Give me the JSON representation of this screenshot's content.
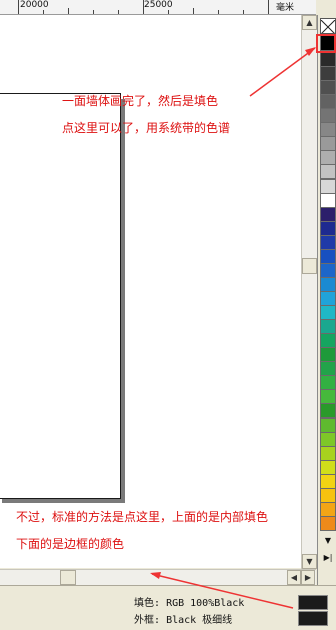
{
  "ruler": {
    "label_left": "20000",
    "label_right": "25000",
    "unit": "毫米"
  },
  "annotations": {
    "top_line1": "一面墙体画完了，然后是填色",
    "top_line2": "点这里可以了，用系统带的色谱",
    "bottom_line1": "不过，标准的方法是点这里，上面的是内部填色",
    "bottom_line2": "下面的是边框的颜色"
  },
  "palette": {
    "no_color_label": "no-fill",
    "selected": "#000000",
    "swatches": [
      "#2a2a2a",
      "#3d3d3d",
      "#505050",
      "#626262",
      "#747474",
      "#878787",
      "#9a9a9a",
      "#aeaeae",
      "#c2c2c2",
      "#d7d7d7",
      "#ffffff",
      "#2c1f6b",
      "#1e2a90",
      "#1f3aa8",
      "#1850c0",
      "#1d66c9",
      "#1a8ad2",
      "#20a3d9",
      "#1fb7c6",
      "#1aa88f",
      "#16a560",
      "#1e9a3a",
      "#22a34a",
      "#32b042",
      "#46b93c",
      "#2a9a2a",
      "#5fba2f",
      "#7ec728",
      "#a8d21e",
      "#d0de1a",
      "#f1d314",
      "#f6c20f",
      "#f2a516",
      "#ee8a1a"
    ]
  },
  "status": {
    "fill_label": "填色:",
    "fill_value": "RGB 100%Black",
    "outline_label": "外框:",
    "outline_value": "Black  极细线"
  },
  "icons": {
    "no_color": "no-fill-icon",
    "scroll_up": "scroll-up-icon",
    "scroll_down": "scroll-down-icon",
    "scroll_left": "scroll-left-icon",
    "scroll_right": "scroll-right-icon",
    "palette_down": "palette-down-icon",
    "palette_expand": "palette-expand-icon"
  },
  "colors": {
    "annotation": "#dd1111",
    "highlight": "#ee3333"
  }
}
